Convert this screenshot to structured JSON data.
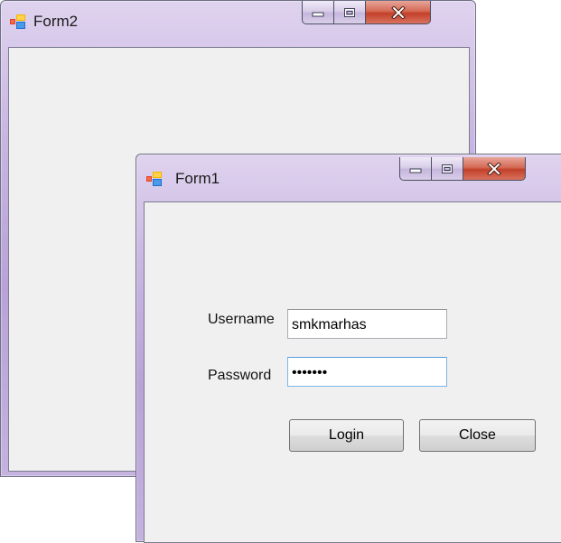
{
  "form2": {
    "title": "Form2"
  },
  "form1": {
    "title": "Form1",
    "username_label": "Username",
    "username_value": "smkmarhas",
    "password_label": "Password",
    "password_value": "•••••••",
    "login_label": "Login",
    "close_label": "Close"
  },
  "colors": {
    "titlebar": "#c9b6e2",
    "client_background": "#f0f0f0",
    "close_button": "#c2402a",
    "input_focus_border": "#7eb4ea"
  },
  "icons": {
    "app": "winforms-app-icon",
    "minimize": "minimize-icon",
    "maximize": "maximize-icon",
    "close": "close-x-icon"
  }
}
